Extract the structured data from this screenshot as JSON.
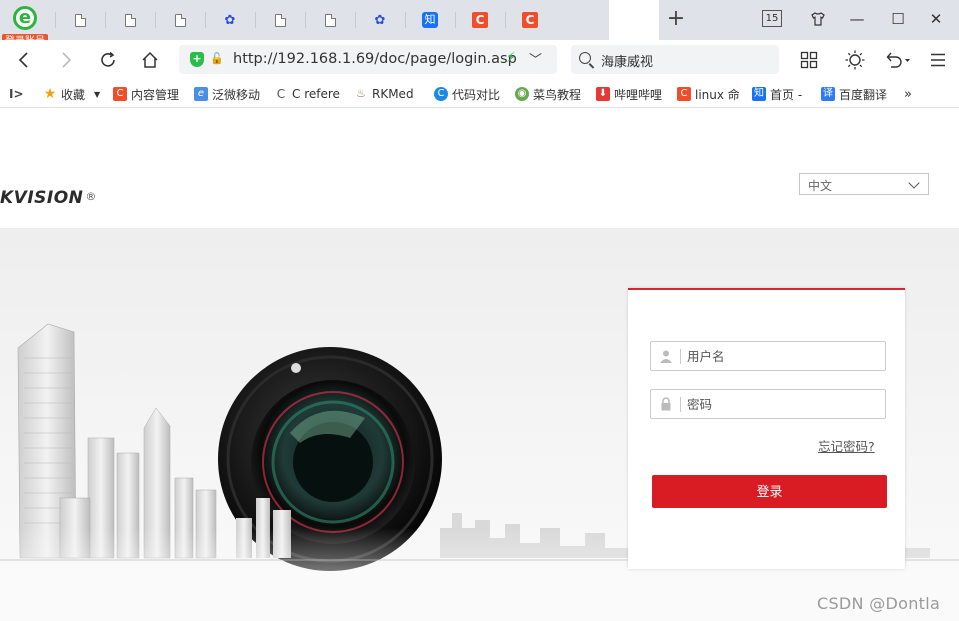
{
  "browser": {
    "logo_letter": "e",
    "login_badge": "登录账号",
    "tab_count": "15",
    "new_tab": "+",
    "window_controls": {
      "skin": "shirt-icon",
      "minimize": "—",
      "maximize": "☐",
      "close": "✕"
    }
  },
  "address_bar": {
    "url": "http://192.168.1.69/doc/page/login.asp",
    "search_text": "海康威视"
  },
  "bookmarks": {
    "toggle": "I>",
    "items": [
      {
        "label": "收藏",
        "icon": "star-icon",
        "color": "#f2a20c"
      },
      {
        "label": "内容管理",
        "icon": "c",
        "color": "#f04d2b"
      },
      {
        "label": "泛微移动",
        "icon": "e",
        "color": "#4a90e2"
      },
      {
        "label": "C refere",
        "icon": "C",
        "color": "#555555"
      },
      {
        "label": "RKMed",
        "icon": "firefly-icon",
        "color": "#8a6a3a"
      },
      {
        "label": "代码对比",
        "icon": "compare-icon",
        "color": "#1e88e5"
      },
      {
        "label": "菜鸟教程",
        "icon": "runoob-icon",
        "color": "#6aa84f"
      },
      {
        "label": "哔哩哔哩",
        "icon": "download-icon",
        "color": "#e53935"
      },
      {
        "label": "linux 命",
        "icon": "c",
        "color": "#f04d2b"
      },
      {
        "label": "首页 -",
        "icon": "知",
        "color": "#1772f6"
      },
      {
        "label": "百度翻译",
        "icon": "译",
        "color": "#2f7bf6"
      }
    ],
    "more": "»"
  },
  "page": {
    "brand": "KVISION",
    "brand_mark": "®",
    "language": "中文",
    "login": {
      "username_placeholder": "用户名",
      "password_placeholder": "密码",
      "forgot_password": "忘记密码?",
      "submit": "登录"
    },
    "accent_color": "#d91c24"
  },
  "watermark": "CSDN @Dontla"
}
